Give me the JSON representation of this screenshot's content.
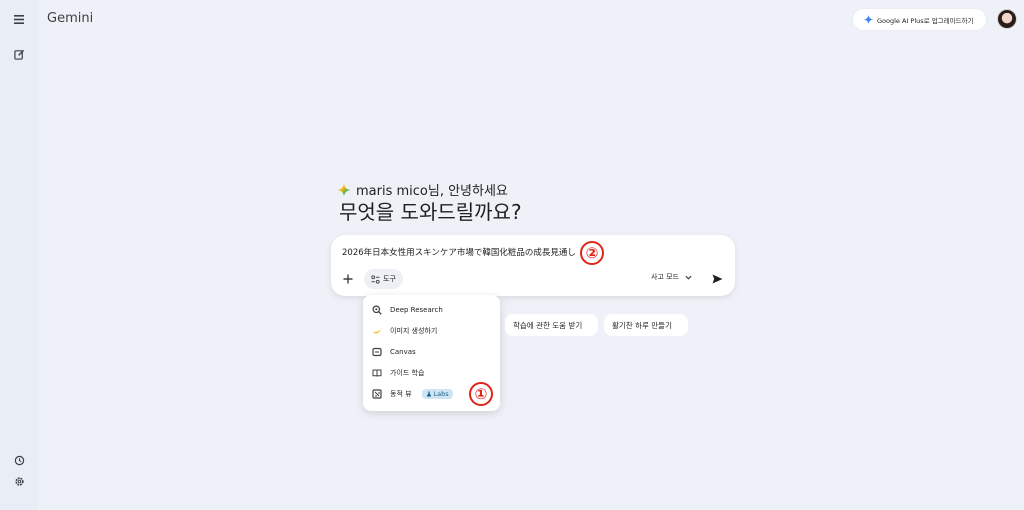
{
  "app": {
    "title": "Gemini"
  },
  "header": {
    "upgrade_label": "Google AI Plus로 업그레이드하기"
  },
  "sidebar": {
    "menu_icon": "menu-icon",
    "new_chat_icon": "edit-icon",
    "activity_icon": "history-icon",
    "settings_icon": "gear-icon"
  },
  "greeting": {
    "line": "maris mico님, 안녕하세요",
    "headline": "무엇을 도와드릴까요?"
  },
  "composer": {
    "prompt_value": "2026年日本女性用スキンケア市場で韓国化粧品の成長見通し",
    "tools_label": "도구",
    "mode_label": "사고 모드"
  },
  "tools_menu": {
    "items": [
      {
        "label": "Deep Research",
        "icon": "deep-research-icon"
      },
      {
        "label": "이미지 생성하기",
        "icon": "banana-icon"
      },
      {
        "label": "Canvas",
        "icon": "canvas-icon"
      },
      {
        "label": "가이드 학습",
        "icon": "book-icon"
      },
      {
        "label": "동적 뷰",
        "icon": "dynamic-view-icon",
        "badge": "Labs"
      }
    ]
  },
  "suggestions": [
    {
      "label": "학습에 관한 도움 받기"
    },
    {
      "label": "활기찬 하루 만들기"
    }
  ],
  "annotations": {
    "marker1": "①",
    "marker2": "②"
  },
  "colors": {
    "background": "#eef1f7",
    "marker": "#e2231a",
    "labs_bg": "#cfe5f4"
  }
}
